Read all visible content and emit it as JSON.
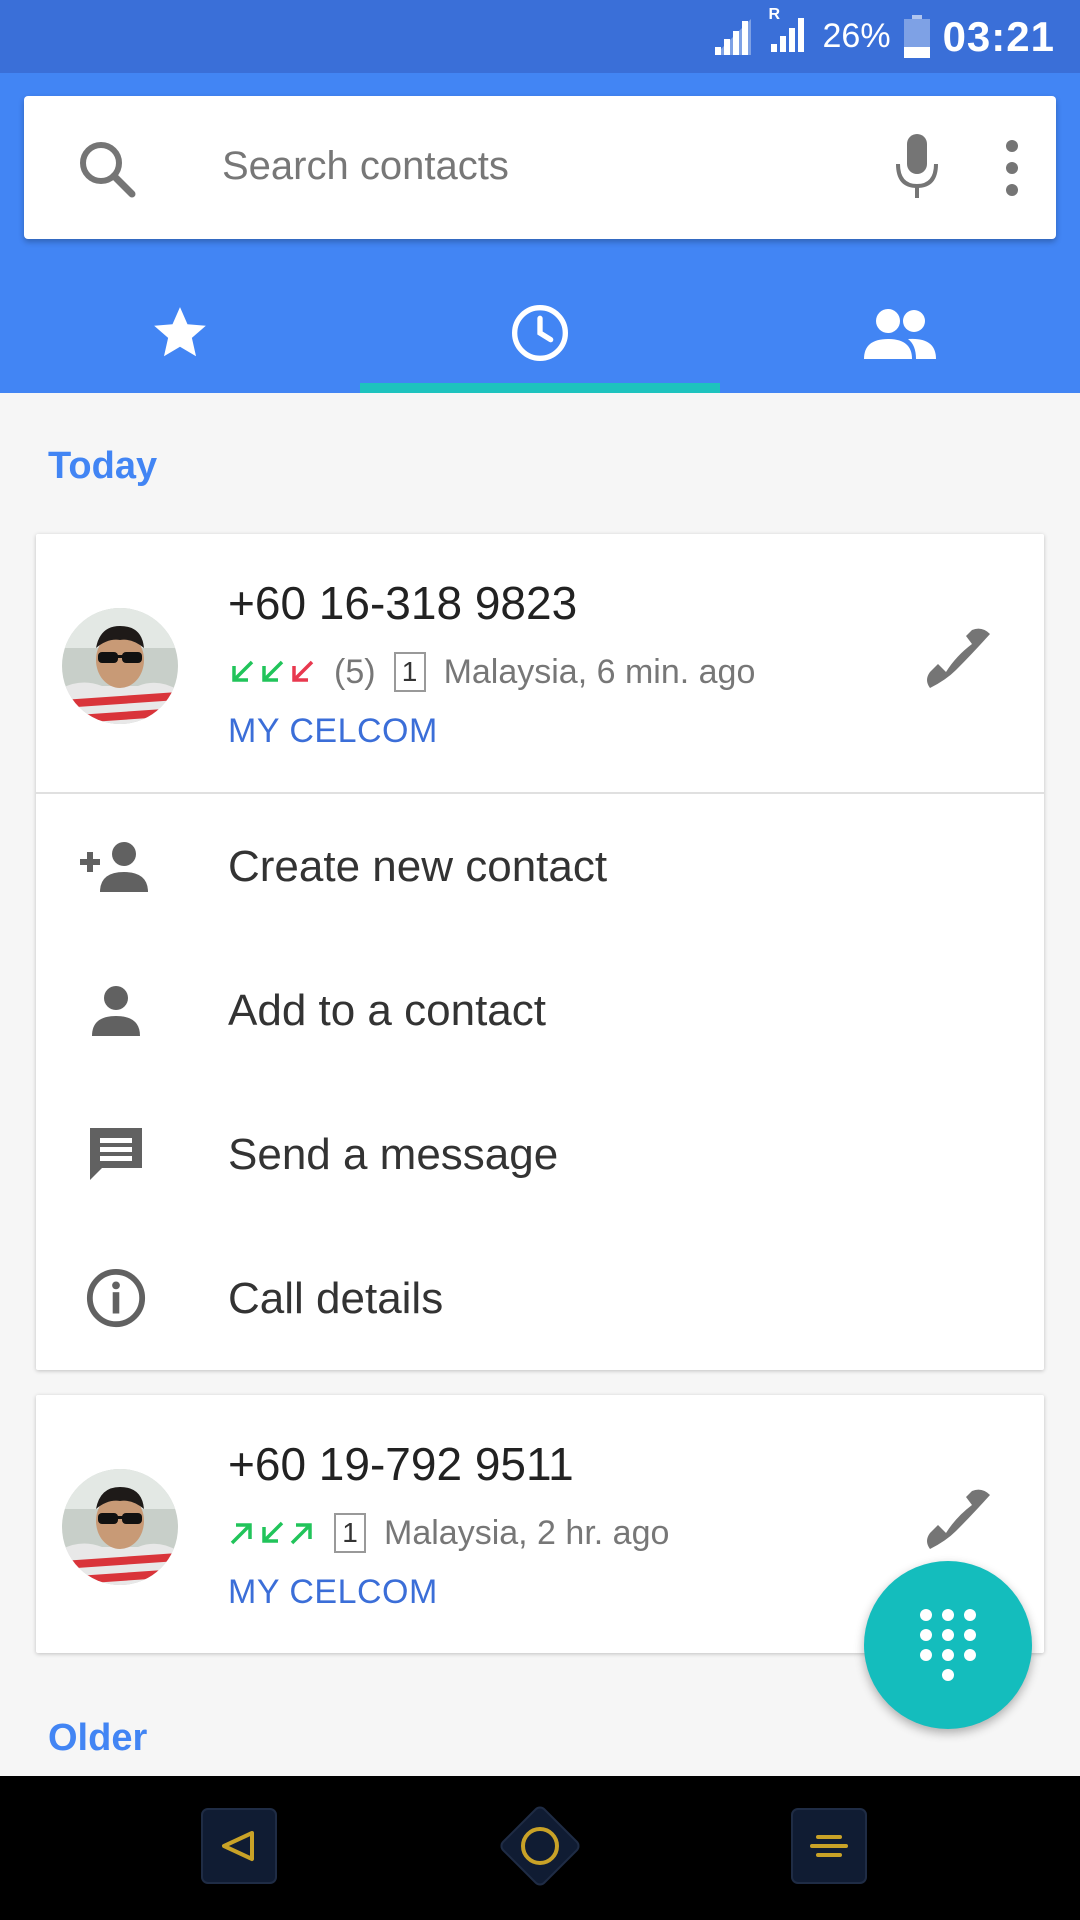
{
  "status_bar": {
    "roaming_indicator": "R",
    "battery_percent": "26%",
    "time": "03:21"
  },
  "search": {
    "placeholder": "Search contacts"
  },
  "tabs": [
    {
      "icon": "star-icon",
      "label": "Speed dial"
    },
    {
      "icon": "clock-icon",
      "label": "Recents",
      "selected": true
    },
    {
      "icon": "people-icon",
      "label": "Contacts"
    }
  ],
  "sections": {
    "today": "Today",
    "older": "Older"
  },
  "calls": [
    {
      "number": "+60 16-318 9823",
      "call_types": [
        "incoming",
        "incoming",
        "missed"
      ],
      "count": "(5)",
      "sim": "1",
      "location_time": "Malaysia, 6 min. ago",
      "account": "MY CELCOM"
    },
    {
      "number": "+60 19-792 9511",
      "call_types": [
        "outgoing",
        "incoming",
        "outgoing"
      ],
      "count": "",
      "sim": "1",
      "location_time": "Malaysia, 2 hr. ago",
      "account": "MY CELCOM"
    }
  ],
  "actions": [
    {
      "icon": "add-person-icon",
      "label": "Create new contact"
    },
    {
      "icon": "person-icon",
      "label": "Add to a contact"
    },
    {
      "icon": "message-icon",
      "label": "Send a message"
    },
    {
      "icon": "info-icon",
      "label": "Call details"
    }
  ],
  "colors": {
    "status_bar": "#3a6fd8",
    "app_bar": "#4285f4",
    "tab_indicator": "#1dc3be",
    "fab": "#14bdbd",
    "incoming_arrow": "#21c45a",
    "missed_arrow": "#e8384f",
    "account_text": "#3b6ed8"
  }
}
